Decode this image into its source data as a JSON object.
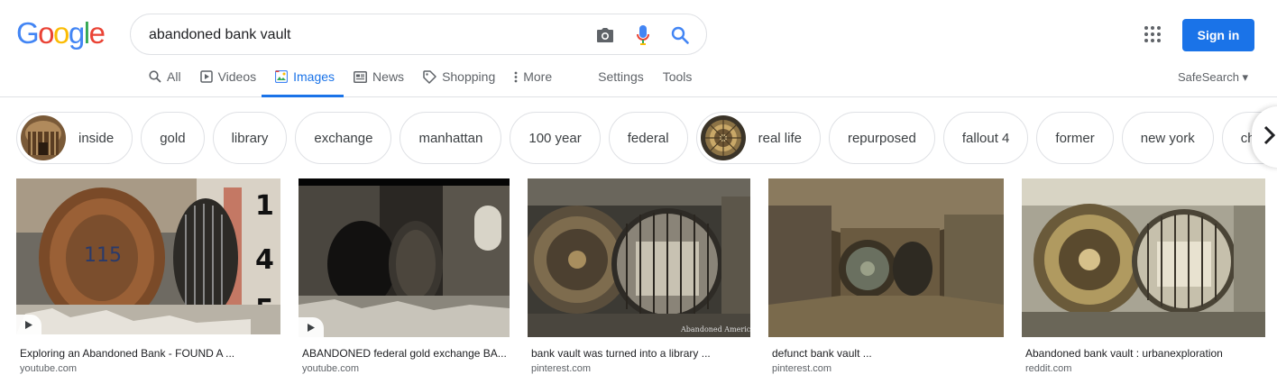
{
  "header": {
    "logo": [
      "G",
      "o",
      "o",
      "g",
      "l",
      "e"
    ],
    "logo_colors": [
      "#4285f4",
      "#ea4335",
      "#fbbc05",
      "#4285f4",
      "#34a853",
      "#ea4335"
    ],
    "search_value": "abandoned bank vault",
    "signin_label": "Sign in",
    "safesearch_label": "SafeSearch ▾",
    "accent_color": "#1a73e8"
  },
  "tabs": [
    {
      "label": "All",
      "icon": "search-icon"
    },
    {
      "label": "Videos",
      "icon": "play-icon"
    },
    {
      "label": "Images",
      "icon": "image-icon",
      "active": true
    },
    {
      "label": "News",
      "icon": "news-icon"
    },
    {
      "label": "Shopping",
      "icon": "tag-icon"
    },
    {
      "label": "More",
      "icon": "more-vert-icon"
    },
    {
      "label": "Settings"
    },
    {
      "label": "Tools"
    }
  ],
  "chips": [
    {
      "label": "inside",
      "has_thumb": true
    },
    {
      "label": "gold"
    },
    {
      "label": "library"
    },
    {
      "label": "exchange"
    },
    {
      "label": "manhattan"
    },
    {
      "label": "100 year"
    },
    {
      "label": "federal"
    },
    {
      "label": "real life",
      "has_thumb": true
    },
    {
      "label": "repurposed"
    },
    {
      "label": "fallout 4"
    },
    {
      "label": "former"
    },
    {
      "label": "new york"
    },
    {
      "label": "chicago va"
    }
  ],
  "results": [
    {
      "title": "Exploring an Abandoned Bank - FOUND A ...",
      "site": "youtube.com",
      "video": true
    },
    {
      "title": "ABANDONED federal gold exchange BA...",
      "site": "youtube.com",
      "video": true
    },
    {
      "title": "bank vault was turned into a library ...",
      "site": "pinterest.com",
      "watermark": "Abandoned America"
    },
    {
      "title": "defunct bank vault ...",
      "site": "pinterest.com"
    },
    {
      "title": "Abandoned bank vault : urbanexploration",
      "site": "reddit.com"
    }
  ]
}
